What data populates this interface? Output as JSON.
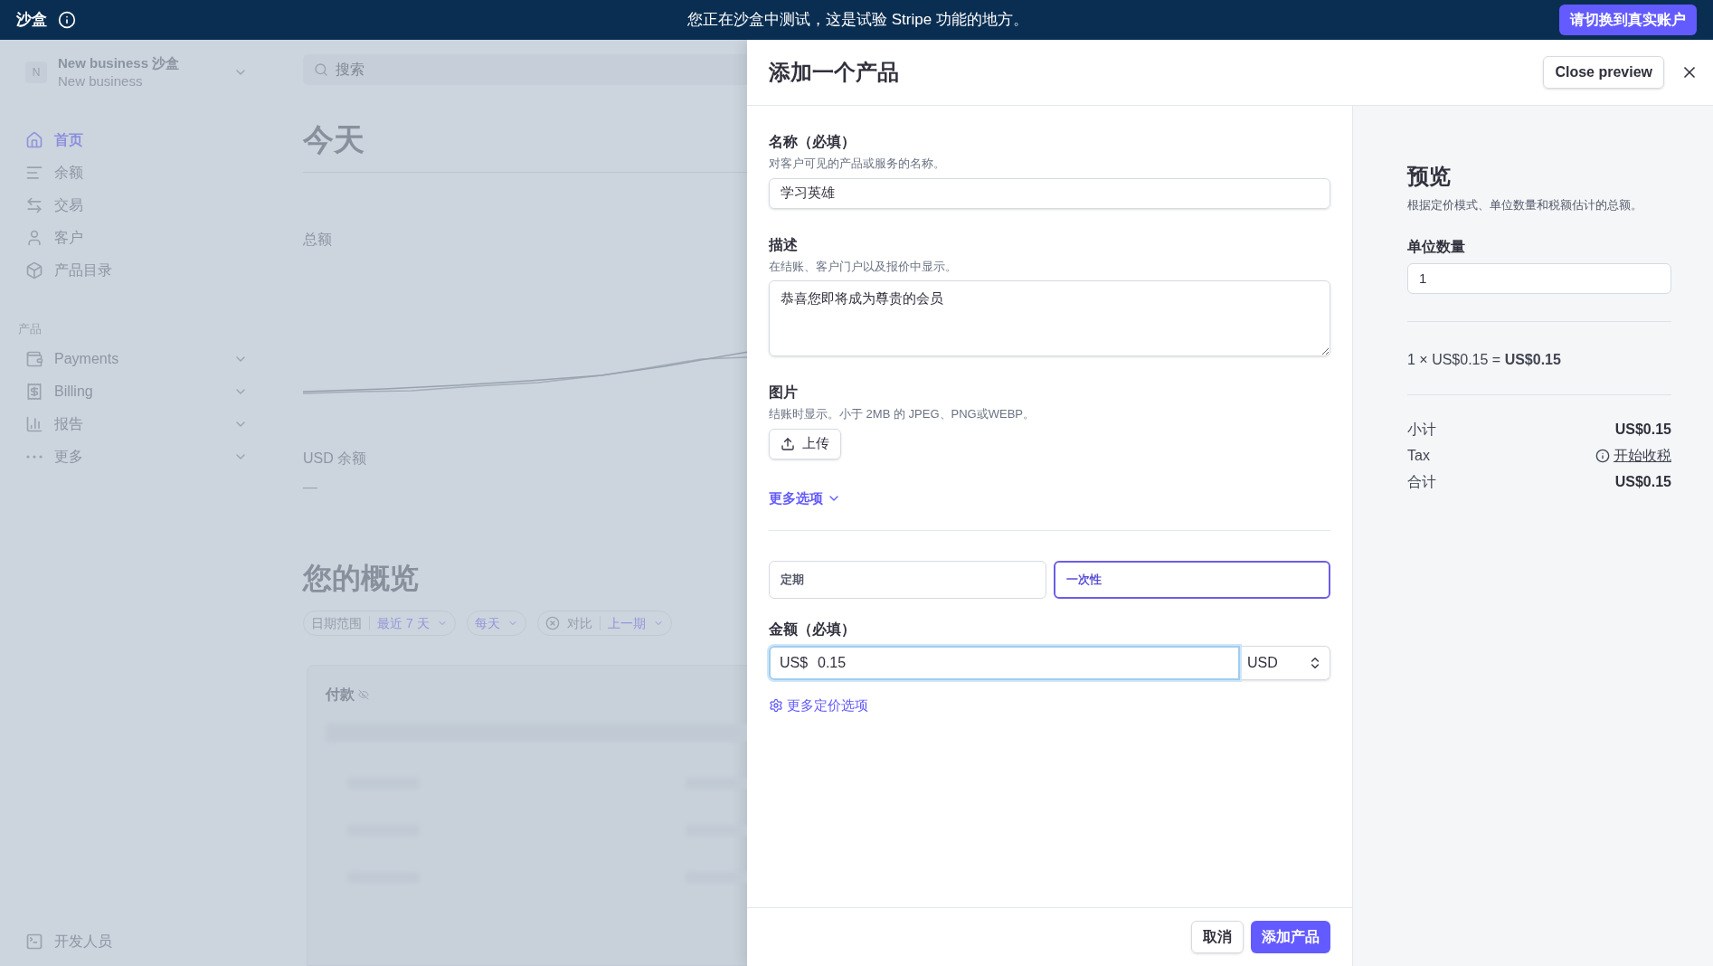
{
  "top_bar": {
    "label": "沙盒",
    "message": "您正在沙盒中测试，这是试验 Stripe 功能的地方。",
    "button": "请切换到真实账户"
  },
  "sidebar": {
    "account": {
      "initial": "N",
      "name": "New business 沙盒",
      "subtitle": "New business"
    },
    "items": [
      {
        "label": "首页",
        "selected": true
      },
      {
        "label": "余额",
        "selected": false
      },
      {
        "label": "交易",
        "selected": false
      },
      {
        "label": "客户",
        "selected": false
      },
      {
        "label": "产品目录",
        "selected": false
      }
    ],
    "section_title": "产品",
    "groups": [
      {
        "label": "Payments"
      },
      {
        "label": "Billing"
      },
      {
        "label": "报告"
      },
      {
        "label": "更多"
      }
    ],
    "footer_item": "开发人员"
  },
  "dashboard": {
    "search": {
      "placeholder": "搜索"
    },
    "today_title": "今天",
    "total_label": "总额",
    "balance_label": "USD 余额",
    "balance_value": "—",
    "overview_title": "您的概览",
    "filters": [
      {
        "kind": "range",
        "label": "日期范围",
        "value": "最近 7 天"
      },
      {
        "kind": "select",
        "value": "每天"
      },
      {
        "kind": "compare",
        "label": "对比",
        "value": "上一期"
      }
    ],
    "card_title": "付款"
  },
  "dialog": {
    "title": "添加一个产品",
    "close_preview": "Close preview",
    "fields": [
      {
        "kind": "text",
        "label": "名称（必填）",
        "hint": "对客户可见的产品或服务的名称。",
        "value": "学习英雄"
      },
      {
        "kind": "textarea",
        "label": "描述",
        "hint": "在结账、客户门户以及报价中显示。",
        "value": "恭喜您即将成为尊贵的会员"
      },
      {
        "kind": "upload",
        "label": "图片",
        "hint": "结账时显示。小于 2MB 的 JPEG、PNG或WEBP。",
        "button": "上传"
      }
    ],
    "more_options": "更多选项",
    "pricing_types": [
      {
        "label": "定期",
        "selected": false
      },
      {
        "label": "一次性",
        "selected": true
      }
    ],
    "price": {
      "label": "金额（必填）",
      "prefix": "US$",
      "value": "0.15",
      "currency": "USD",
      "focused": true
    },
    "more_pricing": "更多定价选项",
    "cancel": "取消",
    "submit": "添加产品"
  },
  "preview": {
    "title": "预览",
    "subtitle": "根据定价模式、单位数量和税额估计的总额。",
    "quantity_label": "单位数量",
    "quantity": "1",
    "calculation": "1 × US$0.15 = **US$0.15**",
    "rows": [
      {
        "kind": "amount",
        "label": "小计",
        "value": "US$0.15"
      },
      {
        "kind": "link",
        "label": "Tax",
        "value": "开始收税"
      },
      {
        "kind": "amount",
        "label": "合计",
        "value": "US$0.15"
      }
    ]
  }
}
